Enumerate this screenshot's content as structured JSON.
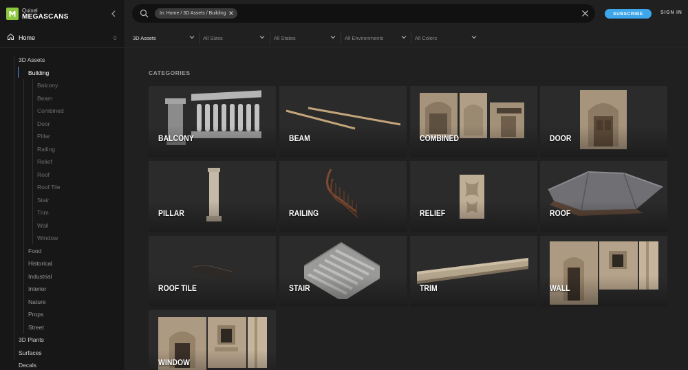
{
  "brand": {
    "line1": "Quixel",
    "line2": "MEGASCANS"
  },
  "sidebar": {
    "home_label": "Home",
    "home_count": "0",
    "tree": [
      {
        "label": "3D Assets",
        "level": 1
      },
      {
        "label": "Building",
        "level": 2,
        "active": true
      },
      {
        "label": "Balcony",
        "level": 3
      },
      {
        "label": "Beam",
        "level": 3
      },
      {
        "label": "Combined",
        "level": 3
      },
      {
        "label": "Door",
        "level": 3
      },
      {
        "label": "Pillar",
        "level": 3
      },
      {
        "label": "Railing",
        "level": 3
      },
      {
        "label": "Relief",
        "level": 3
      },
      {
        "label": "Roof",
        "level": 3
      },
      {
        "label": "Roof Tile",
        "level": 3
      },
      {
        "label": "Stair",
        "level": 3
      },
      {
        "label": "Trim",
        "level": 3
      },
      {
        "label": "Wall",
        "level": 3
      },
      {
        "label": "Window",
        "level": 3
      },
      {
        "label": "Food",
        "level": 2
      },
      {
        "label": "Historical",
        "level": 2
      },
      {
        "label": "Industrial",
        "level": 2
      },
      {
        "label": "Interior",
        "level": 2
      },
      {
        "label": "Nature",
        "level": 2
      },
      {
        "label": "Props",
        "level": 2
      },
      {
        "label": "Street",
        "level": 2
      },
      {
        "label": "3D Plants",
        "level": 1
      },
      {
        "label": "Surfaces",
        "level": 1
      },
      {
        "label": "Decals",
        "level": 1
      }
    ]
  },
  "search": {
    "chip_label": "In: Home / 3D Assets / Building"
  },
  "header": {
    "subscribe_label": "SUBSCRIBE",
    "signin_label": "SIGN IN"
  },
  "filters": [
    {
      "label": "3D Assets",
      "selected": true
    },
    {
      "label": "All Sizes"
    },
    {
      "label": "All States"
    },
    {
      "label": "All Environments"
    },
    {
      "label": "All Colors"
    }
  ],
  "main": {
    "section_title": "CATEGORIES",
    "categories": [
      {
        "name": "BALCONY",
        "art": "balcony"
      },
      {
        "name": "BEAM",
        "art": "beam"
      },
      {
        "name": "COMBINED",
        "art": "combined"
      },
      {
        "name": "DOOR",
        "art": "door"
      },
      {
        "name": "PILLAR",
        "art": "pillar"
      },
      {
        "name": "RAILING",
        "art": "railing"
      },
      {
        "name": "RELIEF",
        "art": "relief"
      },
      {
        "name": "ROOF",
        "art": "roof"
      },
      {
        "name": "ROOF TILE",
        "art": "rooftile"
      },
      {
        "name": "STAIR",
        "art": "stair"
      },
      {
        "name": "TRIM",
        "art": "trim"
      },
      {
        "name": "WALL",
        "art": "wall"
      },
      {
        "name": "WINDOW",
        "art": "window"
      }
    ]
  },
  "colors": {
    "accent": "#3ea6ea",
    "brand": "#8dc63f",
    "selection": "#4a90e2"
  },
  "icons": {
    "brand": "megascans-logo-icon",
    "collapse": "chevron-left-icon",
    "home": "home-icon",
    "search": "search-icon",
    "chip_remove": "close-icon",
    "clear": "close-icon",
    "filter": "chevron-down-icon"
  }
}
